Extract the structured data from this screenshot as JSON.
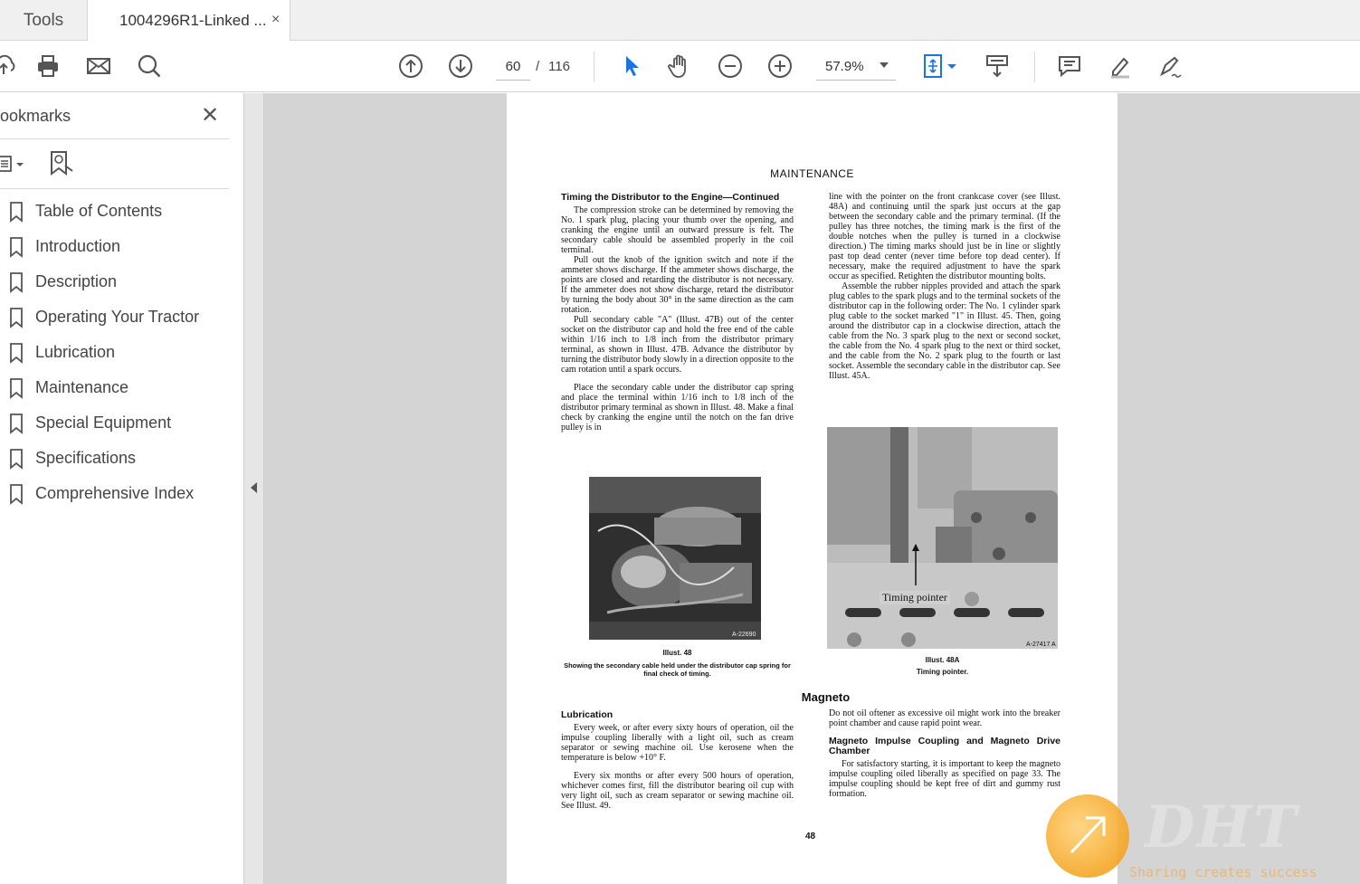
{
  "tabs": {
    "tools_label": "Tools",
    "doc_label": "1004296R1-Linked ...",
    "close_glyph": "×"
  },
  "toolbar": {
    "page_current": "60",
    "page_separator": "/",
    "page_total": "116",
    "zoom": "57.9%"
  },
  "sidebar": {
    "title": "ookmarks",
    "close_glyph": "✕",
    "items": [
      {
        "label": "Table of Contents"
      },
      {
        "label": "Introduction"
      },
      {
        "label": "Description"
      },
      {
        "label": "Operating Your Tractor"
      },
      {
        "label": "Lubrication"
      },
      {
        "label": "Maintenance"
      },
      {
        "label": "Special Equipment"
      },
      {
        "label": "Specifications"
      },
      {
        "label": "Comprehensive Index"
      }
    ]
  },
  "document": {
    "heading": "MAINTENANCE",
    "left_title": "Timing the Distributor to the Engine—Continued",
    "left_p1": "The compression stroke can be determined by removing the No. 1 spark plug, placing your thumb over the opening, and cranking the engine until an outward pressure is felt. The secondary cable should be assembled properly in the coil terminal.",
    "left_p2": "Pull out the knob of the ignition switch and note if the ammeter shows discharge. If the ammeter shows discharge, the points are closed and retarding the distributor is not necessary. If the ammeter does not show discharge, retard the distributor by turning the body about 30° in the same direction as the cam rotation.",
    "left_p3": "Pull secondary cable \"A\" (Illust. 47B) out of the center socket on the distributor cap and hold the free end of the cable within 1/16 inch to 1/8 inch from the distributor primary terminal, as shown in Illust. 47B. Advance the distributor by turning the distributor body slowly in a direction opposite to the cam rotation until a spark occurs.",
    "left_p4": "Place the secondary cable under the distributor cap spring and place the terminal within 1/16 inch to 1/8 inch of the distributor primary terminal as shown in Illust. 48. Make a final check by cranking the engine until the notch on the fan drive pulley is in",
    "right_p1": "line with the pointer on the front crankcase cover (see Illust. 48A) and continuing until the spark just occurs at the gap between the secondary cable and the primary terminal. (If the pulley has three notches, the timing mark is the first of the double notches when the pulley is turned in a clockwise direction.) The timing marks should just be in line or slightly past top dead center (never time before top dead center). If necessary, make the required adjustment to have the spark occur as specified. Retighten the distributor mounting bolts.",
    "right_p2": "Assemble the rubber nipples provided and attach the spark plug cables to the spark plugs and to the terminal sockets of the distributor cap in the following order: The No. 1 cylinder spark plug cable to the socket marked \"1\" in Illust. 45. Then, going around the distributor cap in a clockwise direction, attach the cable from the No. 3 spark plug to the next or second socket, the cable from the No. 4 spark plug to the next or third socket, and the cable from the No. 2 spark plug to the fourth or last socket. Assemble the secondary cable in the distributor cap. See Illust. 45A.",
    "photo1_code": "A-22690",
    "photo2_code": "A-27417 A",
    "photo2_callout": "Timing pointer",
    "caption1_title": "Illust. 48",
    "caption1_text": "Showing the secondary cable held under the distributor cap spring for final check of timing.",
    "caption2_title": "Illust. 48A",
    "caption2_text": "Timing pointer.",
    "magneto_title": "Magneto",
    "lub_title": "Lubrication",
    "lub_p1": "Every week, or after every sixty hours of operation, oil the impulse coupling liberally with a light oil, such as cream separator or sewing machine oil. Use kerosene when the temperature is below +10° F.",
    "lub_p2": "Every six months or after every 500 hours of operation, whichever comes first, fill the distributor bearing oil cup with very light oil, such as cream separator or sewing machine oil. See Illust. 49.",
    "mag_right_p1": "Do not oil oftener as excessive oil might work into the breaker point chamber and cause rapid point wear.",
    "mag_right_title": "Magneto Impulse Coupling and Magneto Drive Chamber",
    "mag_right_p2": "For satisfactory starting, it is important to keep the magneto impulse coupling oiled liberally as specified on page 33. The impulse coupling should be kept free of dirt and gummy rust formation.",
    "page_number": "48"
  },
  "watermark": {
    "logo": "DHT",
    "tagline": "Sharing creates success"
  },
  "colors": {
    "accent_blue": "#1a73e8",
    "icon_gray": "#555555",
    "viewer_bg": "#d4d4d4"
  }
}
